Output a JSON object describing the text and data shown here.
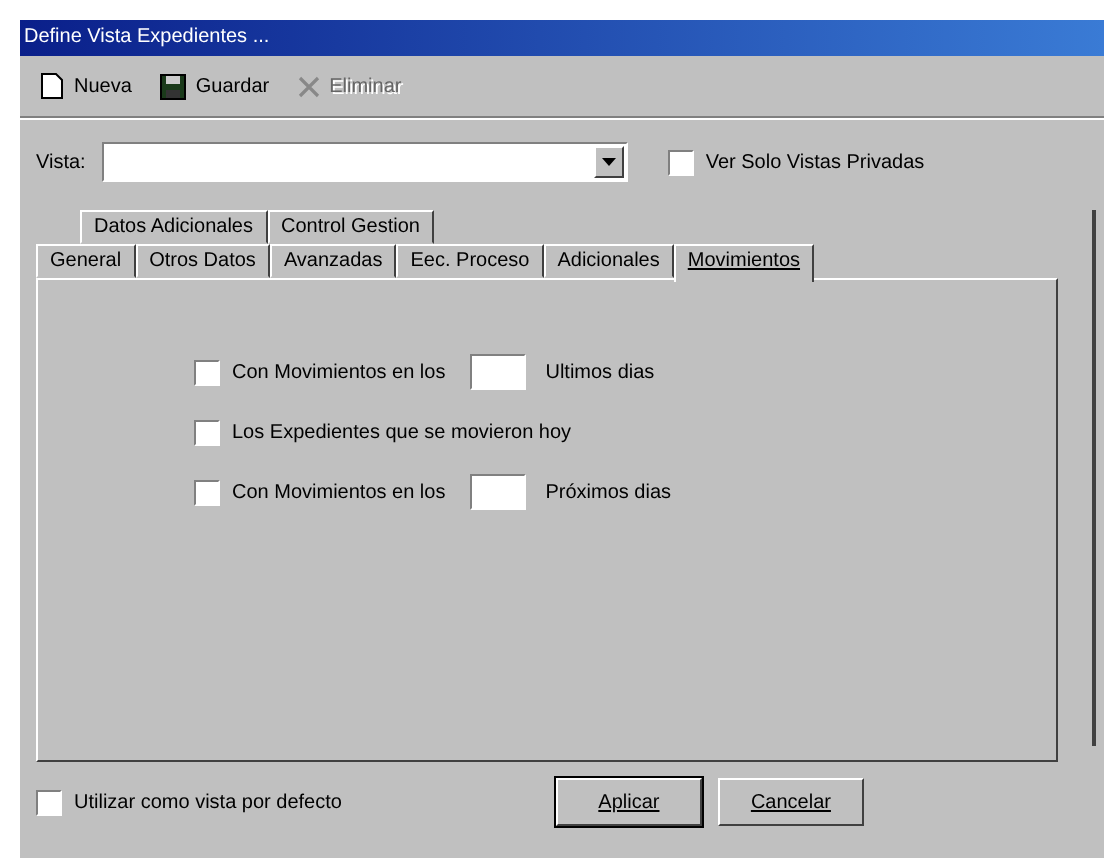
{
  "window": {
    "title": "Define Vista Expedientes ..."
  },
  "toolbar": [
    {
      "kind": "document",
      "label": "Nueva",
      "disabled": false
    },
    {
      "kind": "disk",
      "label": "Guardar",
      "disabled": false
    },
    {
      "kind": "delete",
      "label": "Eliminar",
      "disabled": true
    }
  ],
  "vista": {
    "label": "Vista:"
  },
  "private_checkbox": {
    "label": "Ver Solo Vistas Privadas",
    "checked": false
  },
  "tab_rows": [
    [
      {
        "label": "Datos Adicionales",
        "selected": false
      },
      {
        "label": "Control Gestion",
        "selected": false
      }
    ],
    [
      {
        "label": "General",
        "selected": false
      },
      {
        "label": "Otros Datos",
        "selected": false
      },
      {
        "label": "Avanzadas",
        "selected": false
      },
      {
        "label": "Eec. Proceso",
        "selected": false
      },
      {
        "label": "Adicionales",
        "selected": false
      },
      {
        "label": "Movimientos",
        "selected": true
      }
    ]
  ],
  "options": [
    {
      "kind": "days",
      "label": "Con Movimientos en los",
      "suffix": "Ultimos dias",
      "checked": false
    },
    {
      "kind": "plain",
      "label": "Los Expedientes que se movieron hoy",
      "checked": false
    },
    {
      "kind": "days",
      "label": "Con Movimientos en los",
      "suffix": "Próximos dias",
      "checked": false
    }
  ],
  "default_checkbox": {
    "label": "Utilizar como vista por defecto",
    "checked": false
  },
  "buttons": [
    "Aplicar",
    "Cancelar"
  ]
}
